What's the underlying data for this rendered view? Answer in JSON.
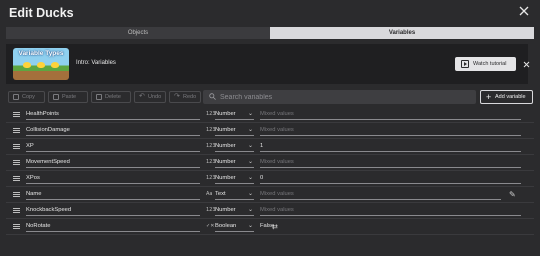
{
  "dialog": {
    "title": "Edit Ducks"
  },
  "tabs": [
    {
      "label": "Objects",
      "active": false
    },
    {
      "label": "Variables",
      "active": true
    }
  ],
  "tutorial": {
    "thumbnail_title": "Variable Types",
    "label": "Intro: Variables",
    "watch_label": "Watch tutorial"
  },
  "toolbar": {
    "copy": "Copy",
    "paste": "Paste",
    "delete": "Delete",
    "undo": "Undo",
    "redo": "Redo",
    "search_placeholder": "Search variables",
    "add_variable": "Add variable"
  },
  "variables": [
    {
      "name": "HealthPoints",
      "type_icon": "123",
      "type": "Number",
      "value": "Mixed values",
      "mixed": true
    },
    {
      "name": "CollisionDamage",
      "type_icon": "123",
      "type": "Number",
      "value": "Mixed values",
      "mixed": true
    },
    {
      "name": "XP",
      "type_icon": "123",
      "type": "Number",
      "value": "1",
      "mixed": false
    },
    {
      "name": "MovementSpeed",
      "type_icon": "123",
      "type": "Number",
      "value": "Mixed values",
      "mixed": true
    },
    {
      "name": "XPos",
      "type_icon": "123",
      "type": "Number",
      "value": "0",
      "mixed": false
    },
    {
      "name": "Name",
      "type_icon": "Aa",
      "type": "Text",
      "value": "Mixed values",
      "mixed": true
    },
    {
      "name": "KnockbackSpeed",
      "type_icon": "123",
      "type": "Number",
      "value": "Mixed values",
      "mixed": true
    },
    {
      "name": "NoRotate",
      "type_icon": "✓✕",
      "type": "Boolean",
      "value": "False",
      "mixed": false
    }
  ],
  "colors": {
    "background": "#2b2b2d",
    "active_tab": "#d9d9dc",
    "banner": "#1f1f21",
    "mixed_text": "#77777b"
  }
}
